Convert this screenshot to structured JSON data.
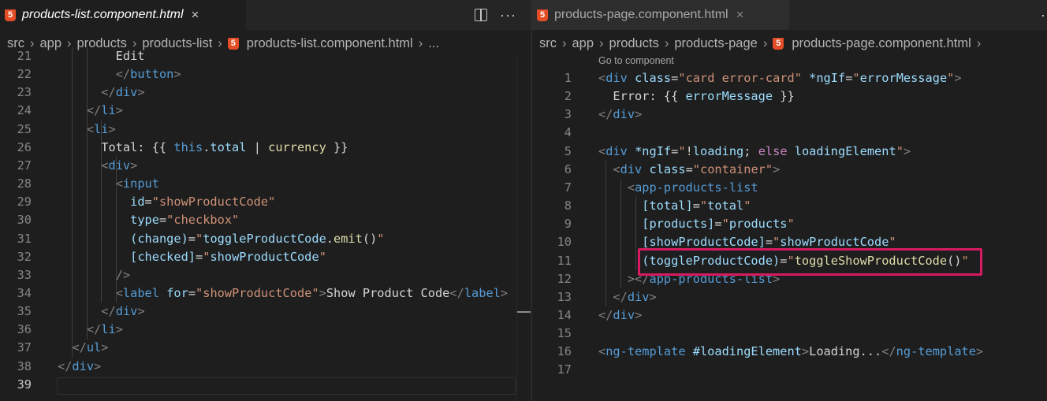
{
  "left": {
    "tab": {
      "title": "products-list.component.html",
      "close": "×"
    },
    "breadcrumb": [
      "src",
      "app",
      "products",
      "products-list",
      "products-list.component.html",
      "..."
    ],
    "lines": [
      {
        "n": "21",
        "indent": 0,
        "tokens": [
          [
            "w",
            "        Edit"
          ]
        ]
      },
      {
        "n": "22",
        "tokens": [
          [
            "w",
            "        "
          ],
          [
            "p",
            "</"
          ],
          [
            "t",
            "button"
          ],
          [
            "p",
            ">"
          ]
        ]
      },
      {
        "n": "23",
        "tokens": [
          [
            "w",
            "      "
          ],
          [
            "p",
            "</"
          ],
          [
            "t",
            "div"
          ],
          [
            "p",
            ">"
          ]
        ]
      },
      {
        "n": "24",
        "tokens": [
          [
            "w",
            "    "
          ],
          [
            "p",
            "</"
          ],
          [
            "t",
            "li"
          ],
          [
            "p",
            ">"
          ]
        ]
      },
      {
        "n": "25",
        "tokens": [
          [
            "w",
            "    "
          ],
          [
            "p",
            "<"
          ],
          [
            "t",
            "li"
          ],
          [
            "p",
            ">"
          ]
        ]
      },
      {
        "n": "26",
        "tokens": [
          [
            "w",
            "      Total: {{ "
          ],
          [
            "t",
            "this"
          ],
          [
            "w",
            "."
          ],
          [
            "v",
            "total"
          ],
          [
            "w",
            " | "
          ],
          [
            "f",
            "currency"
          ],
          [
            "w",
            " }}"
          ]
        ]
      },
      {
        "n": "27",
        "tokens": [
          [
            "w",
            "      "
          ],
          [
            "p",
            "<"
          ],
          [
            "t",
            "div"
          ],
          [
            "p",
            ">"
          ]
        ]
      },
      {
        "n": "28",
        "tokens": [
          [
            "w",
            "        "
          ],
          [
            "p",
            "<"
          ],
          [
            "t",
            "input"
          ]
        ]
      },
      {
        "n": "29",
        "tokens": [
          [
            "w",
            "          "
          ],
          [
            "a",
            "id"
          ],
          [
            "w",
            "="
          ],
          [
            "s",
            "\"showProductCode\""
          ]
        ]
      },
      {
        "n": "30",
        "tokens": [
          [
            "w",
            "          "
          ],
          [
            "a",
            "type"
          ],
          [
            "w",
            "="
          ],
          [
            "s",
            "\"checkbox\""
          ]
        ]
      },
      {
        "n": "31",
        "tokens": [
          [
            "w",
            "          "
          ],
          [
            "a",
            "(change)"
          ],
          [
            "w",
            "="
          ],
          [
            "s",
            "\""
          ],
          [
            "v",
            "toggleProductCode"
          ],
          [
            "w",
            "."
          ],
          [
            "f",
            "emit"
          ],
          [
            "w",
            "()"
          ],
          [
            "s",
            "\""
          ]
        ]
      },
      {
        "n": "32",
        "tokens": [
          [
            "w",
            "          "
          ],
          [
            "a",
            "[checked]"
          ],
          [
            "w",
            "="
          ],
          [
            "s",
            "\""
          ],
          [
            "v",
            "showProductCode"
          ],
          [
            "s",
            "\""
          ]
        ]
      },
      {
        "n": "33",
        "tokens": [
          [
            "w",
            "        "
          ],
          [
            "p",
            "/>"
          ]
        ]
      },
      {
        "n": "34",
        "tokens": [
          [
            "w",
            "        "
          ],
          [
            "p",
            "<"
          ],
          [
            "t",
            "label"
          ],
          [
            "w",
            " "
          ],
          [
            "a",
            "for"
          ],
          [
            "w",
            "="
          ],
          [
            "s",
            "\"showProductCode\""
          ],
          [
            "p",
            ">"
          ],
          [
            "w",
            "Show Product Code"
          ],
          [
            "p",
            "</"
          ],
          [
            "t",
            "label"
          ],
          [
            "p",
            ">"
          ]
        ]
      },
      {
        "n": "35",
        "tokens": [
          [
            "w",
            "      "
          ],
          [
            "p",
            "</"
          ],
          [
            "t",
            "div"
          ],
          [
            "p",
            ">"
          ]
        ]
      },
      {
        "n": "36",
        "tokens": [
          [
            "w",
            "    "
          ],
          [
            "p",
            "</"
          ],
          [
            "t",
            "li"
          ],
          [
            "p",
            ">"
          ]
        ]
      },
      {
        "n": "37",
        "tokens": [
          [
            "w",
            "  "
          ],
          [
            "p",
            "</"
          ],
          [
            "t",
            "ul"
          ],
          [
            "p",
            ">"
          ]
        ]
      },
      {
        "n": "38",
        "tokens": [
          [
            "p",
            "</"
          ],
          [
            "t",
            "div"
          ],
          [
            "p",
            ">"
          ]
        ]
      },
      {
        "n": "39",
        "tokens": []
      }
    ]
  },
  "right": {
    "tab": {
      "title": "products-page.component.html",
      "close": "×"
    },
    "breadcrumb": [
      "src",
      "app",
      "products",
      "products-page",
      "products-page.component.html"
    ],
    "codelens": "Go to component",
    "lines": [
      {
        "n": "1",
        "tokens": [
          [
            "p",
            "<"
          ],
          [
            "t",
            "div"
          ],
          [
            "w",
            " "
          ],
          [
            "a",
            "class"
          ],
          [
            "w",
            "="
          ],
          [
            "s",
            "\"card error-card\""
          ],
          [
            "w",
            " "
          ],
          [
            "a",
            "*ngIf"
          ],
          [
            "w",
            "="
          ],
          [
            "s",
            "\""
          ],
          [
            "v",
            "errorMessage"
          ],
          [
            "s",
            "\""
          ],
          [
            "p",
            ">"
          ]
        ]
      },
      {
        "n": "2",
        "tokens": [
          [
            "w",
            "  Error: {{ "
          ],
          [
            "v",
            "errorMessage"
          ],
          [
            "w",
            " }}"
          ]
        ]
      },
      {
        "n": "3",
        "tokens": [
          [
            "p",
            "</"
          ],
          [
            "t",
            "div"
          ],
          [
            "p",
            ">"
          ]
        ]
      },
      {
        "n": "4",
        "tokens": []
      },
      {
        "n": "5",
        "tokens": [
          [
            "p",
            "<"
          ],
          [
            "t",
            "div"
          ],
          [
            "w",
            " "
          ],
          [
            "a",
            "*ngIf"
          ],
          [
            "w",
            "="
          ],
          [
            "s",
            "\""
          ],
          [
            "w",
            "!"
          ],
          [
            "v",
            "loading"
          ],
          [
            "w",
            "; "
          ],
          [
            "k",
            "else"
          ],
          [
            "w",
            " "
          ],
          [
            "v",
            "loadingElement"
          ],
          [
            "s",
            "\""
          ],
          [
            "p",
            ">"
          ]
        ]
      },
      {
        "n": "6",
        "tokens": [
          [
            "w",
            "  "
          ],
          [
            "p",
            "<"
          ],
          [
            "t",
            "div"
          ],
          [
            "w",
            " "
          ],
          [
            "a",
            "class"
          ],
          [
            "w",
            "="
          ],
          [
            "s",
            "\"container\""
          ],
          [
            "p",
            ">"
          ]
        ]
      },
      {
        "n": "7",
        "tokens": [
          [
            "w",
            "    "
          ],
          [
            "p",
            "<"
          ],
          [
            "t",
            "app-products-list"
          ]
        ]
      },
      {
        "n": "8",
        "tokens": [
          [
            "w",
            "      "
          ],
          [
            "a",
            "[total]"
          ],
          [
            "w",
            "="
          ],
          [
            "s",
            "\""
          ],
          [
            "v",
            "total"
          ],
          [
            "s",
            "\""
          ]
        ]
      },
      {
        "n": "9",
        "tokens": [
          [
            "w",
            "      "
          ],
          [
            "a",
            "[products]"
          ],
          [
            "w",
            "="
          ],
          [
            "s",
            "\""
          ],
          [
            "v",
            "products"
          ],
          [
            "s",
            "\""
          ]
        ]
      },
      {
        "n": "10",
        "tokens": [
          [
            "w",
            "      "
          ],
          [
            "a",
            "[showProductCode]"
          ],
          [
            "w",
            "="
          ],
          [
            "s",
            "\""
          ],
          [
            "v",
            "showProductCode"
          ],
          [
            "s",
            "\""
          ]
        ]
      },
      {
        "n": "11",
        "tokens": [
          [
            "w",
            "      "
          ],
          [
            "a",
            "(toggleProductCode)"
          ],
          [
            "w",
            "="
          ],
          [
            "s",
            "\""
          ],
          [
            "f",
            "toggleShowProductCode"
          ],
          [
            "w",
            "()"
          ],
          [
            "s",
            "\""
          ]
        ]
      },
      {
        "n": "12",
        "tokens": [
          [
            "w",
            "    "
          ],
          [
            "p",
            "></"
          ],
          [
            "t",
            "app-products-list"
          ],
          [
            "p",
            ">"
          ]
        ]
      },
      {
        "n": "13",
        "tokens": [
          [
            "w",
            "  "
          ],
          [
            "p",
            "</"
          ],
          [
            "t",
            "div"
          ],
          [
            "p",
            ">"
          ]
        ]
      },
      {
        "n": "14",
        "tokens": [
          [
            "p",
            "</"
          ],
          [
            "t",
            "div"
          ],
          [
            "p",
            ">"
          ]
        ]
      },
      {
        "n": "15",
        "tokens": []
      },
      {
        "n": "16",
        "tokens": [
          [
            "p",
            "<"
          ],
          [
            "t",
            "ng-template"
          ],
          [
            "w",
            " "
          ],
          [
            "a",
            "#loadingElement"
          ],
          [
            "p",
            ">"
          ],
          [
            "w",
            "Loading..."
          ],
          [
            "p",
            "</"
          ],
          [
            "t",
            "ng-template"
          ],
          [
            "p",
            ">"
          ]
        ]
      },
      {
        "n": "17",
        "tokens": []
      }
    ]
  },
  "colors": {
    "highlight": "#d81b60",
    "html_icon": "#e44d26"
  }
}
